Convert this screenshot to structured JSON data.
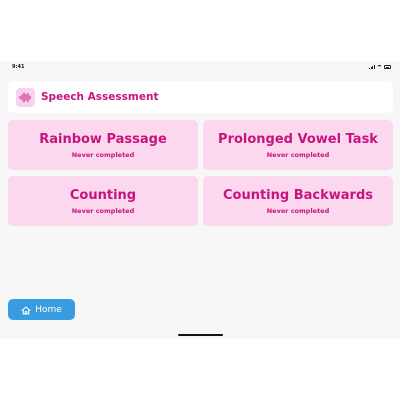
{
  "status_bar": {
    "time": "9:41",
    "icons": [
      "signal-icon",
      "wifi-icon",
      "battery-icon"
    ]
  },
  "header": {
    "icon": "waveform-icon",
    "title": "Speech Assessment"
  },
  "tasks": [
    {
      "title": "Rainbow Passage",
      "status": "Never completed"
    },
    {
      "title": "Prolonged Vowel Task",
      "status": "Never completed"
    },
    {
      "title": "Counting",
      "status": "Never completed"
    },
    {
      "title": "Counting Backwards",
      "status": "Never completed"
    }
  ],
  "home_button": {
    "icon": "house-icon",
    "label": "Home"
  },
  "colors": {
    "accent": "#c8137f",
    "card_background": "#fcd8ee",
    "button": "#3a9ce0",
    "page_background": "#f7f7f8"
  }
}
